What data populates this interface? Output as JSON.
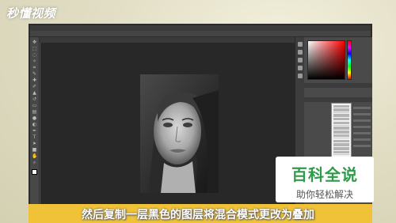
{
  "logo": {
    "text": "秒懂视频"
  },
  "photoshop": {
    "doc_tab": "",
    "panels": {
      "layer_rows": 7
    }
  },
  "watermark": {
    "title": "百科全说",
    "subtitle": "助你轻松解决",
    "accent_color": "#2e9a4a"
  },
  "subtitle": "然后复制一层黑色的图层将混合模式更改为叠加",
  "colors": {
    "subtitle_bar": "#f0c238",
    "ps_dark": "#282828",
    "ps_panel": "#4a4a4a",
    "selection_blue": "#2a6bd6"
  }
}
